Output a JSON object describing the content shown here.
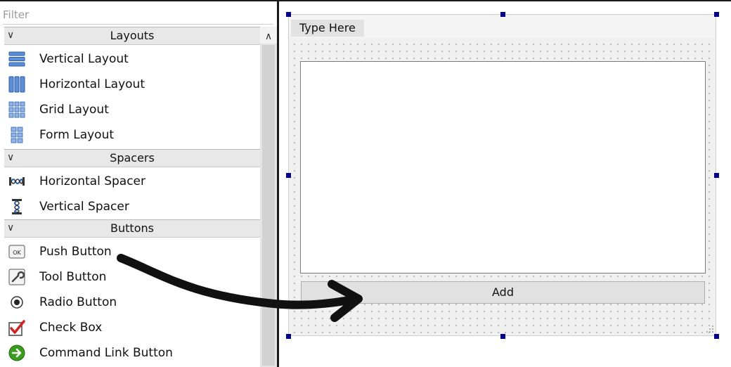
{
  "widget_box": {
    "filter_placeholder": "Filter",
    "categories": {
      "layouts": "Layouts",
      "spacers": "Spacers",
      "buttons": "Buttons"
    },
    "items": {
      "vertical_layout": "Vertical Layout",
      "horizontal_layout": "Horizontal Layout",
      "grid_layout": "Grid Layout",
      "form_layout": "Form Layout",
      "horizontal_spacer": "Horizontal Spacer",
      "vertical_spacer": "Vertical Spacer",
      "push_button": "Push Button",
      "tool_button": "Tool Button",
      "radio_button": "Radio Button",
      "check_box": "Check Box",
      "command_link_button": "Command Link Button"
    },
    "push_button_icon_text": "OK"
  },
  "form": {
    "menu_placeholder": "Type Here",
    "add_button_label": "Add"
  },
  "icons": {
    "category_chevron": "chevron-down-icon",
    "scroll_up": "chevron-up-icon",
    "annotation": "curved-arrow-icon"
  },
  "colors": {
    "selection_handle": "#00008b",
    "category_bg": "#e8e8e8",
    "form_bg": "#f0f0f0"
  }
}
